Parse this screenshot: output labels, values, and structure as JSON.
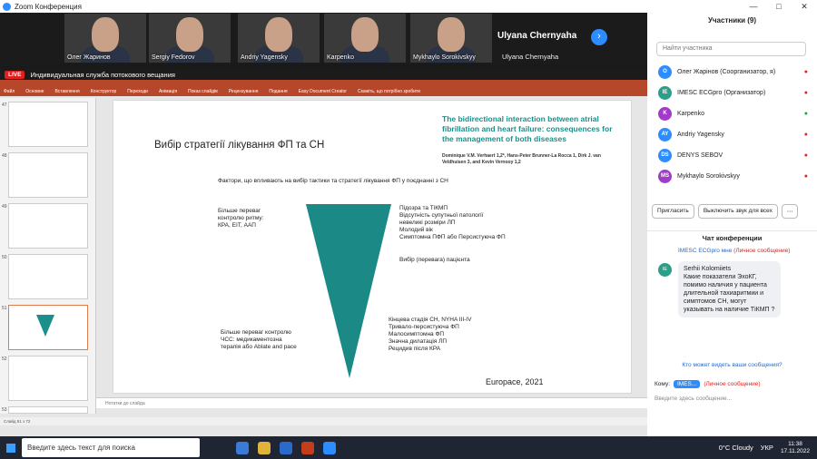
{
  "window": {
    "title": "Zoom Конференция"
  },
  "videos": [
    {
      "name": "Олег Жаринов"
    },
    {
      "name": "Sergiy Fedorov"
    },
    {
      "name": "Andriy Yagensky"
    },
    {
      "name": "Karpenko"
    },
    {
      "name": "Mykhaylo Sorokivskyy"
    }
  ],
  "active_speaker": {
    "big_name": "Ulyana Chernyaha",
    "small_name": "Ulyana Chernyaha"
  },
  "live": {
    "badge": "LIVE",
    "text": "Индивидуальная служба потокового вещания"
  },
  "ppt": {
    "ribbon": [
      "Файл",
      "Основне",
      "Вставлення",
      "Конструктор",
      "Переходи",
      "Анімація",
      "Показ слайдів",
      "Рецензування",
      "Подання",
      "Easy Document Creator",
      "Скажіть, що потрібно зробити"
    ],
    "slide_numbers": [
      "47",
      "48",
      "49",
      "50",
      "51",
      "52",
      "53"
    ],
    "notes_placeholder": "Нотатки до слайда",
    "status": "Слайд 51 з 72"
  },
  "slide": {
    "title": "Вибір стратегії лікування ФП та СН",
    "article_title": "The bidirectional interaction between atrial fibrillation and heart failure: consequences for the management of both diseases",
    "authors": "Dominique V.M. Verhaert 1,2*, Hans-Peter Brunner-La Rocca 1, Dirk J. van Veldhuisen 3, and Kevin Vernooy 1,2",
    "factors": "Фактори, що впливають на вибір тактики та стратегії лікування ФП у поєднанні з СН",
    "left_top": "Більше переваг\nконтролю ритму:\nКРА, ЕІТ, ААП",
    "right_top": "Підозра та ТіКМП\nВідсутність супутньої патології\nневеликі розміри ЛП\nМолодий вік\nСимптомна ПФП або Персистуюча ФП",
    "middle": "Вибір (перевага) пацієнта",
    "right_bottom": "Кінцева стадія СН, NYHA III-IV\nТривало-персистуюча ФП\nМалосимптомна ФП\nЗначна дилатація ЛП\nРецидив після КРА",
    "left_bottom": "Більше переваг контролю\nЧСС: медикаментозна\nтерапія або Ablate and pace",
    "source": "Europace, 2021"
  },
  "participants": {
    "header": "Участники (9)",
    "search_placeholder": "Найти участника",
    "list": [
      {
        "initials": "О",
        "name": "Олег Жарінов (Соорганизатор, я)",
        "color": "#2d8cff"
      },
      {
        "initials": "IE",
        "name": "IMESC ECGpro (Организатор)",
        "color": "#2aa08a"
      },
      {
        "initials": "K",
        "name": "Karpenko",
        "color": "#a23bc8"
      },
      {
        "initials": "AY",
        "name": "Andriy Yagensky",
        "color": "#2d8cff"
      },
      {
        "initials": "DS",
        "name": "DENYS SEBOV",
        "color": "#2d8cff"
      },
      {
        "initials": "MS",
        "name": "Mykhaylo Sorokivskyy",
        "color": "#a23bc8"
      }
    ],
    "invite_btn": "Пригласить",
    "mute_btn": "Выключить звук для всех"
  },
  "chat": {
    "header": "Чат конференции",
    "from": "IMESC ECGpro мне",
    "private": "(Личное сообщение)",
    "avatar": "IE",
    "message": "Serhii Kolomiiets\nКакие показатели ЭхоКГ, помимо наличия у пациента длительной тахиаритмии и симптомов СН, могут указывать на наличие ТіКМП ?",
    "who_can_see": "Кто может видеть ваши сообщения?",
    "to_label": "Кому:",
    "to_value": "IMES...",
    "to_private": "(Личное сообщение)",
    "input_placeholder": "Введите здесь сообщение..."
  },
  "taskbar": {
    "search_placeholder": "Введите здесь текст для поиска",
    "weather": "0°C  Cloudy",
    "lang": "УКР",
    "time": "11:38",
    "date": "17.11.2022"
  }
}
